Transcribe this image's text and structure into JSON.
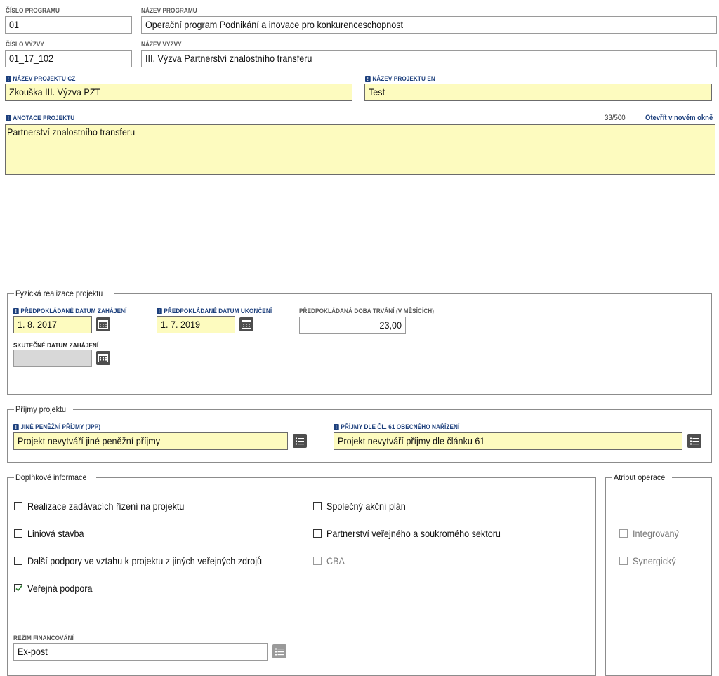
{
  "program": {
    "number_label": "ČÍSLO PROGRAMU",
    "number_value": "01",
    "name_label": "NÁZEV PROGRAMU",
    "name_value": "Operační program Podnikání a inovace pro konkurenceschopnost"
  },
  "call": {
    "number_label": "ČÍSLO VÝZVY",
    "number_value": "01_17_102",
    "name_label": "NÁZEV VÝZVY",
    "name_value": "III. Výzva Partnerství znalostního transferu"
  },
  "project": {
    "name_cz_label": "NÁZEV PROJEKTU CZ",
    "name_cz_value": "Zkouška III. Výzva PZT",
    "name_en_label": "NÁZEV PROJEKTU EN",
    "name_en_value": "Test",
    "annotation_label": "ANOTACE PROJEKTU",
    "annotation_counter": "33/500",
    "annotation_open_link": "Otevřít v novém okně",
    "annotation_value": "Partnerství znalostního transferu"
  },
  "physical": {
    "legend": "Fyzická realizace projektu",
    "start_label": "PŘEDPOKLÁDANÉ DATUM ZAHÁJENÍ",
    "start_value": "1. 8. 2017",
    "end_label": "PŘEDPOKLÁDANÉ DATUM UKONČENÍ",
    "end_value": "1. 7. 2019",
    "duration_label": "PŘEDPOKLÁDANÁ DOBA TRVÁNÍ (V MĚSÍCÍCH)",
    "duration_value": "23,00",
    "actual_start_label": "SKUTEČNÉ DATUM ZAHÁJENÍ",
    "actual_start_value": ""
  },
  "income": {
    "legend": "Příjmy projektu",
    "jpp_label": "JINÉ PENĚŽNÍ PŘÍJMY (JPP)",
    "jpp_value": "Projekt nevytváří jiné peněžní příjmy",
    "art61_label": "PŘÍJMY DLE ČL. 61 OBECNÉHO NAŘÍZENÍ",
    "art61_value": "Projekt nevytváří příjmy dle článku 61"
  },
  "additional": {
    "legend": "Doplňkové informace",
    "checkboxes": [
      {
        "label": "Realizace zadávacích řízení na projektu",
        "checked": false
      },
      {
        "label": "Liniová stavba",
        "checked": false
      },
      {
        "label": "Další podpory ve vztahu k projektu z jiných veřejných zdrojů",
        "checked": false
      },
      {
        "label": "Veřejná podpora",
        "checked": true
      },
      {
        "label": "Společný akční plán",
        "checked": false
      },
      {
        "label": "Partnerství veřejného a soukromého sektoru",
        "checked": false
      },
      {
        "label": "CBA",
        "checked": false
      }
    ],
    "financing_label": "REŽIM FINANCOVÁNÍ",
    "financing_value": "Ex-post"
  },
  "attribute": {
    "legend": "Atribut operace",
    "checkboxes": [
      {
        "label": "Integrovaný",
        "checked": false
      },
      {
        "label": "Synergický",
        "checked": false
      }
    ]
  },
  "icons": {
    "required": "exclamation-icon",
    "calendar": "calendar-icon",
    "list": "list-icon",
    "check": "check-icon"
  },
  "colors": {
    "required_label": "#1c3f7c",
    "required_field": "#fdfbbf",
    "disabled_field": "#d8d8d8",
    "check": "#2e7d32"
  }
}
